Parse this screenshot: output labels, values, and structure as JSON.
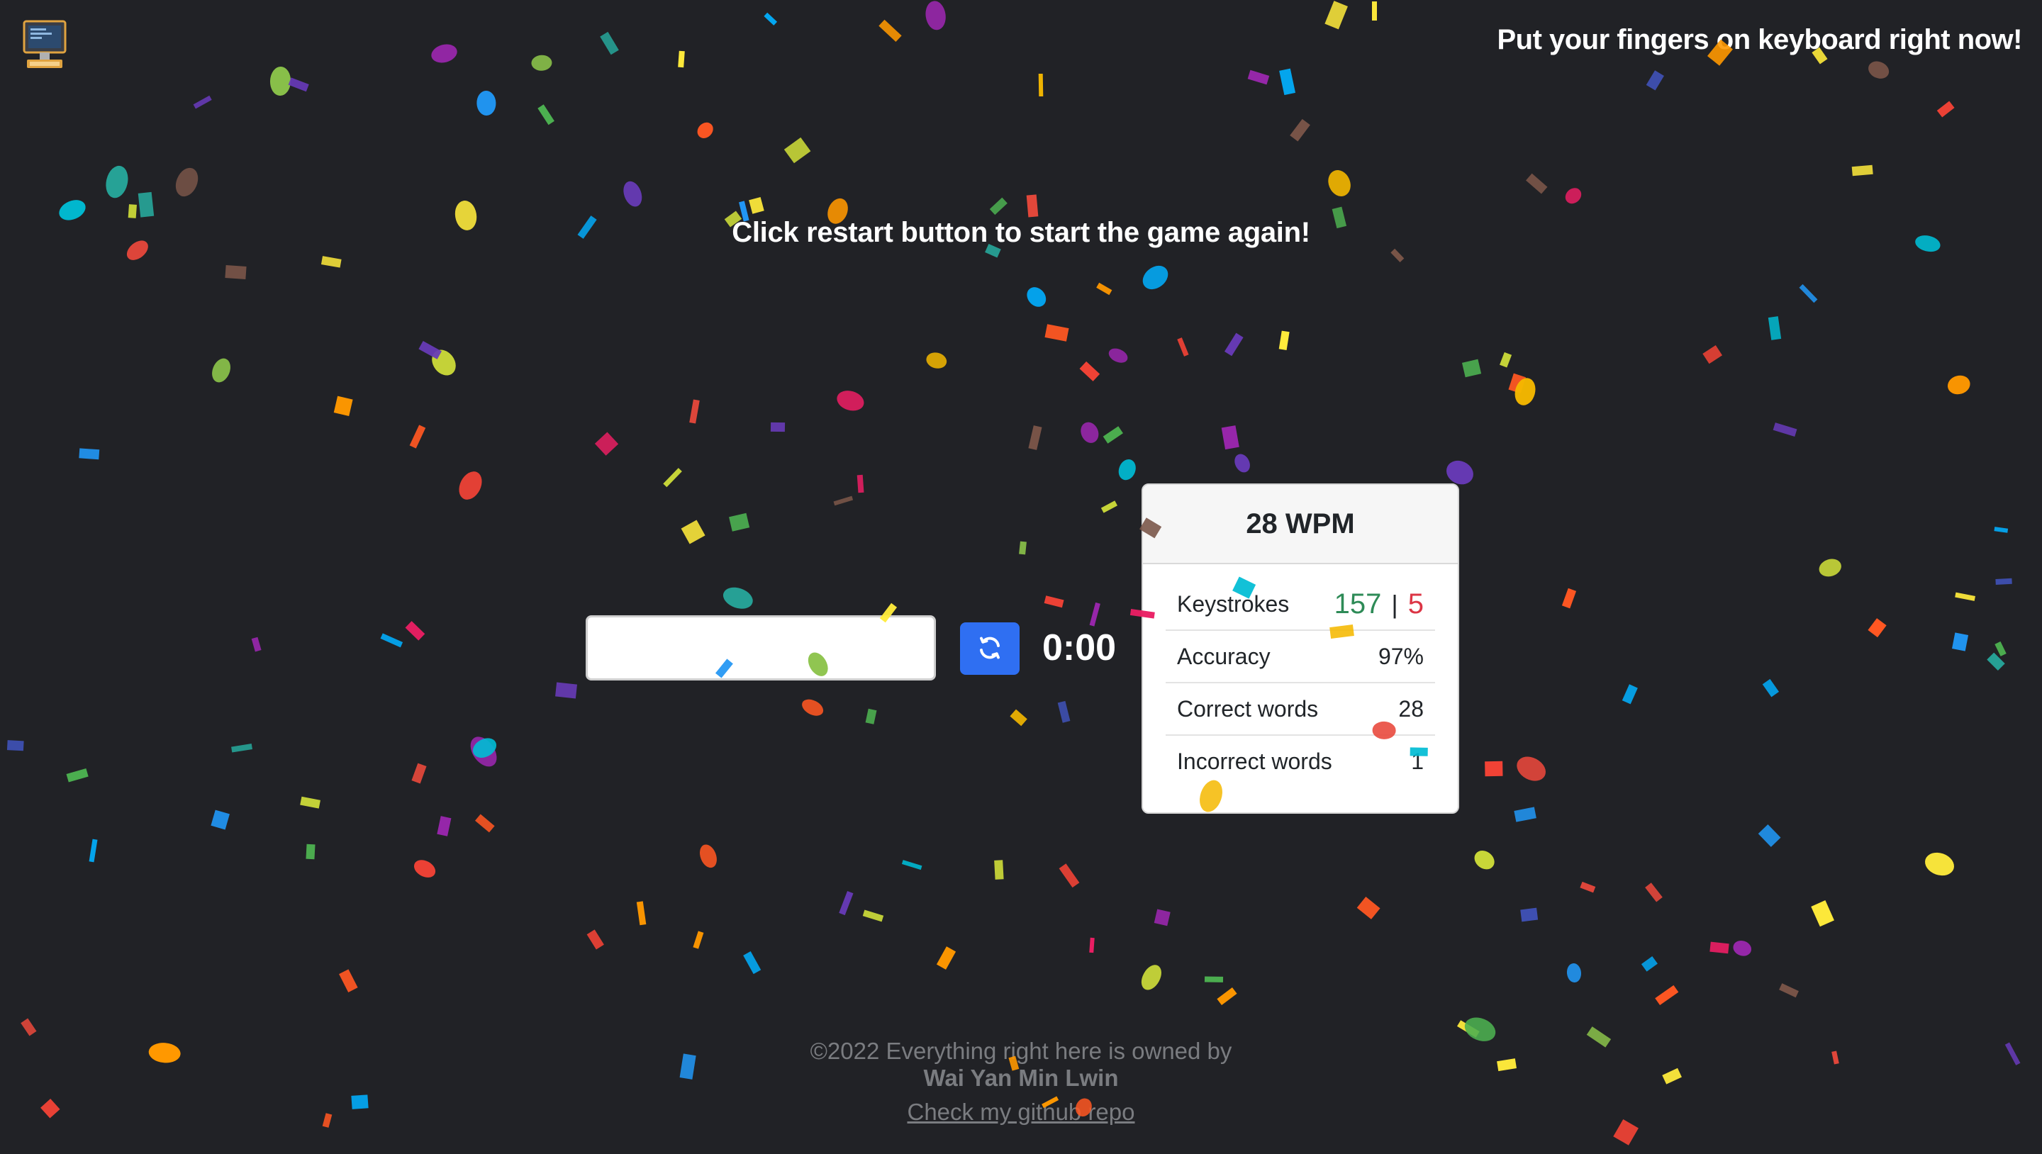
{
  "header": {
    "tagline": "Put your fingers on keyboard right now!",
    "app_icon": "computer-icon"
  },
  "game": {
    "restart_message": "Click restart button to start the game again!",
    "input_value": "",
    "input_placeholder": "",
    "restart_icon": "refresh-icon",
    "timer": "0:00"
  },
  "stats": {
    "wpm": "28 WPM",
    "keystrokes_label": "Keystrokes",
    "keystrokes_correct": "157",
    "keystrokes_separator": "|",
    "keystrokes_incorrect": "5",
    "accuracy_label": "Accuracy",
    "accuracy_value": "97%",
    "correct_words_label": "Correct words",
    "correct_words_value": "28",
    "incorrect_words_label": "Incorrect words",
    "incorrect_words_value": "1"
  },
  "footer": {
    "copyright": "©2022 Everything right here is owned by",
    "owner": "Wai Yan Min Lwin",
    "repo_link": "Check my github repo"
  },
  "colors": {
    "background": "#212226",
    "accent": "#2f6ff2",
    "correct": "#2e8b57",
    "incorrect": "#dc3545",
    "confetti_palette": [
      "#e8483b",
      "#f5b800",
      "#4caf50",
      "#2196f3",
      "#9c27b0",
      "#e91e63",
      "#ff5722",
      "#8bc34a",
      "#03a9f4",
      "#ffeb3b",
      "#673ab7",
      "#00bcd4",
      "#ff9800",
      "#cddc39",
      "#26a69a",
      "#795548",
      "#3f51b5",
      "#f44336"
    ]
  }
}
